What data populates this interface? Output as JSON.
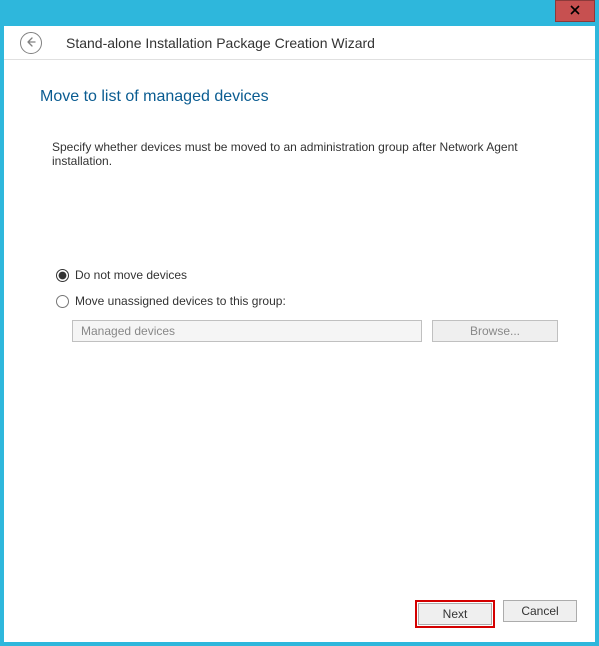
{
  "window": {
    "title": "Stand-alone Installation Package Creation Wizard"
  },
  "page": {
    "heading": "Move to list of managed devices",
    "description": "Specify whether devices must be moved to an administration group after Network Agent installation."
  },
  "radios": {
    "dont_move_label": "Do not move devices",
    "move_to_group_label": "Move unassigned devices to this group:"
  },
  "group_input": {
    "value": "Managed devices"
  },
  "buttons": {
    "browse": "Browse...",
    "next": "Next",
    "cancel": "Cancel"
  }
}
